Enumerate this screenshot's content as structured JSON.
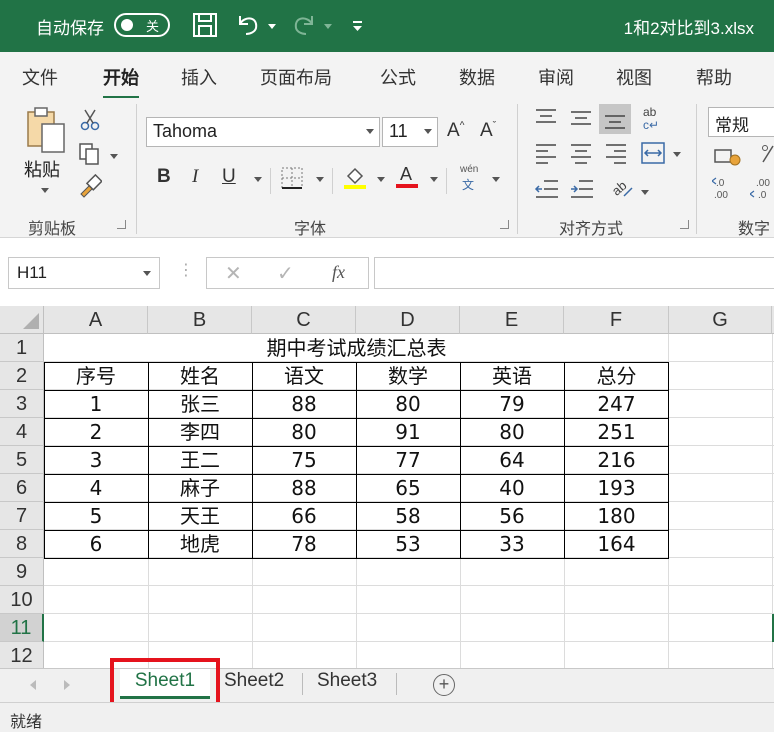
{
  "titlebar": {
    "autosave_label": "自动保存",
    "autosave_state": "关",
    "filename": "1和2对比到3.xlsx"
  },
  "tabs": [
    "文件",
    "开始",
    "插入",
    "页面布局",
    "公式",
    "数据",
    "审阅",
    "视图",
    "帮助"
  ],
  "active_tab": "开始",
  "ribbon": {
    "clipboard": {
      "paste_label": "粘贴",
      "group_label": "剪贴板"
    },
    "font": {
      "font_name": "Tahoma",
      "font_size": "11",
      "bold": "B",
      "italic": "I",
      "underline": "U",
      "phonetic_top": "wén",
      "phonetic_bottom": "文",
      "group_label": "字体"
    },
    "alignment": {
      "group_label": "对齐方式"
    },
    "number": {
      "format": "常规",
      "group_label": "数字"
    }
  },
  "formula_bar": {
    "name_box": "H11",
    "cancel": "✕",
    "enter": "✓",
    "fx": "fx",
    "content": ""
  },
  "columns": [
    "A",
    "B",
    "C",
    "D",
    "E",
    "F",
    "G"
  ],
  "rows": [
    "1",
    "2",
    "3",
    "4",
    "5",
    "6",
    "7",
    "8",
    "9",
    "10",
    "11",
    "12"
  ],
  "selected_row": "11",
  "sheet": {
    "title": "期中考试成绩汇总表",
    "headers": [
      "序号",
      "姓名",
      "语文",
      "数学",
      "英语",
      "总分"
    ],
    "data": [
      [
        "1",
        "张三",
        "88",
        "80",
        "79",
        "247"
      ],
      [
        "2",
        "李四",
        "80",
        "91",
        "80",
        "251"
      ],
      [
        "3",
        "王二",
        "75",
        "77",
        "64",
        "216"
      ],
      [
        "4",
        "麻子",
        "88",
        "65",
        "40",
        "193"
      ],
      [
        "5",
        "天王",
        "66",
        "58",
        "56",
        "180"
      ],
      [
        "6",
        "地虎",
        "78",
        "53",
        "33",
        "164"
      ]
    ]
  },
  "sheet_tabs": [
    "Sheet1",
    "Sheet2",
    "Sheet3"
  ],
  "active_sheet": "Sheet1",
  "status": "就绪",
  "colors": {
    "accent": "#217346",
    "highlight": "#e5131d"
  }
}
